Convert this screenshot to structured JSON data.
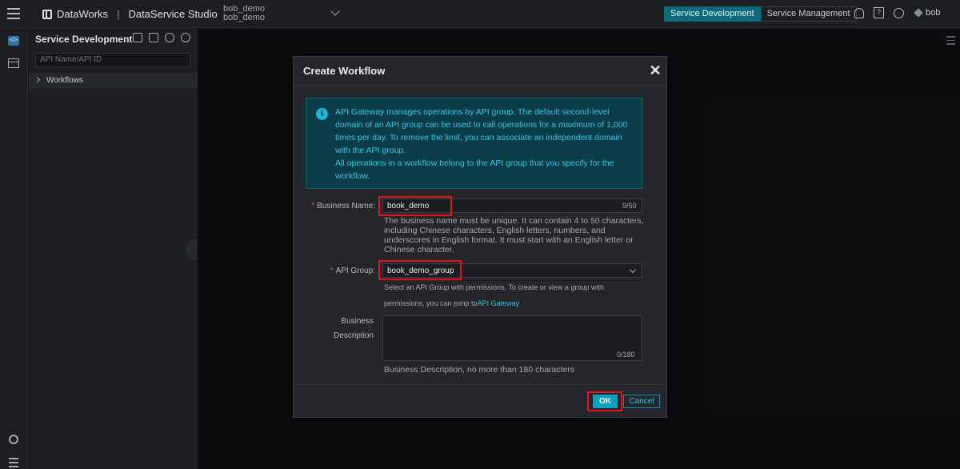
{
  "topbar": {
    "product": "DataWorks",
    "module": "DataService Studio",
    "workspace_line1": "bob_demo",
    "workspace_line2": "bob_demo",
    "mode_tabs": [
      "Service Development",
      "Service Management"
    ],
    "active_mode": "Service Development",
    "user": "bob",
    "help_glyph": "?"
  },
  "rail": {
    "code_glyph": "</>"
  },
  "sidebar": {
    "title": "Service Development",
    "search_placeholder": "API Name/API ID",
    "tree_items": [
      "Workflows"
    ]
  },
  "modal": {
    "title": "Create Workflow",
    "close_glyph": "✕",
    "notice_icon_glyph": "i",
    "notice": {
      "paragraph1": "API Gateway manages operations by API group. The default second-level domain of an API group can be used to call operations for a maximum of 1,000 times per day. To remove the limit, you can associate an independent domain with the API group.",
      "paragraph2": "All operations in a workflow belong to the API group that you specify for the workflow."
    },
    "business_name": {
      "required_mark": "*",
      "label": "Business Name:",
      "value": "book_demo",
      "counter": "9/50",
      "help": "The business name must be unique. It can contain 4 to 50 characters, including Chinese characters, English letters, numbers, and underscores in English format. It must start with an English letter or Chinese character."
    },
    "api_group": {
      "required_mark": "*",
      "label": "API Group:",
      "value": "book_demo_group",
      "help_line1": "Select an API Group with permissions. To create or view a group with",
      "help_line2_prefix": "permissions, you can jump to",
      "help_link": "API Gateway"
    },
    "description": {
      "label_line1": "Business",
      "label_colon": ":",
      "label_line2": "Description",
      "value": "",
      "counter": "0/180",
      "help": "Business Description, no more than 180 characters"
    },
    "ok_label": "OK",
    "cancel_label": "Cancel"
  },
  "colors": {
    "accent": "#0aa1c6",
    "notice_text": "#2fc3e6",
    "highlight": "#e8101a",
    "required": "#e84c4c"
  },
  "icons": [
    "menu-icon",
    "dataworks-logo-icon",
    "chevron-down-icon",
    "bell-icon",
    "help-icon",
    "wrench-icon",
    "diamond-icon",
    "code-icon",
    "table-icon",
    "gear-icon",
    "add-user-icon",
    "new-file-icon",
    "refresh-icon",
    "locate-icon",
    "info-icon",
    "close-icon"
  ]
}
